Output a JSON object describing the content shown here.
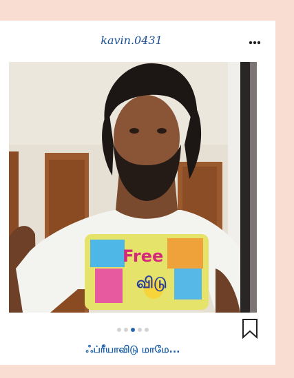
{
  "post": {
    "username": "kavin.0431",
    "caption": "ஃப்ரீயாவிடு மாமே...",
    "more_icon": "more-horizontal-icon",
    "bookmark_icon": "bookmark-icon",
    "carousel": {
      "total": 5,
      "active_index": 3
    },
    "photo_shirt_text": [
      "Free",
      "விடு"
    ]
  },
  "colors": {
    "page_background": "#f9dcd2",
    "card_background": "#ffffff",
    "accent_blue": "#1a5fa8",
    "dot_active": "#2a66ad",
    "dot_inactive": "#d3d3d3"
  }
}
